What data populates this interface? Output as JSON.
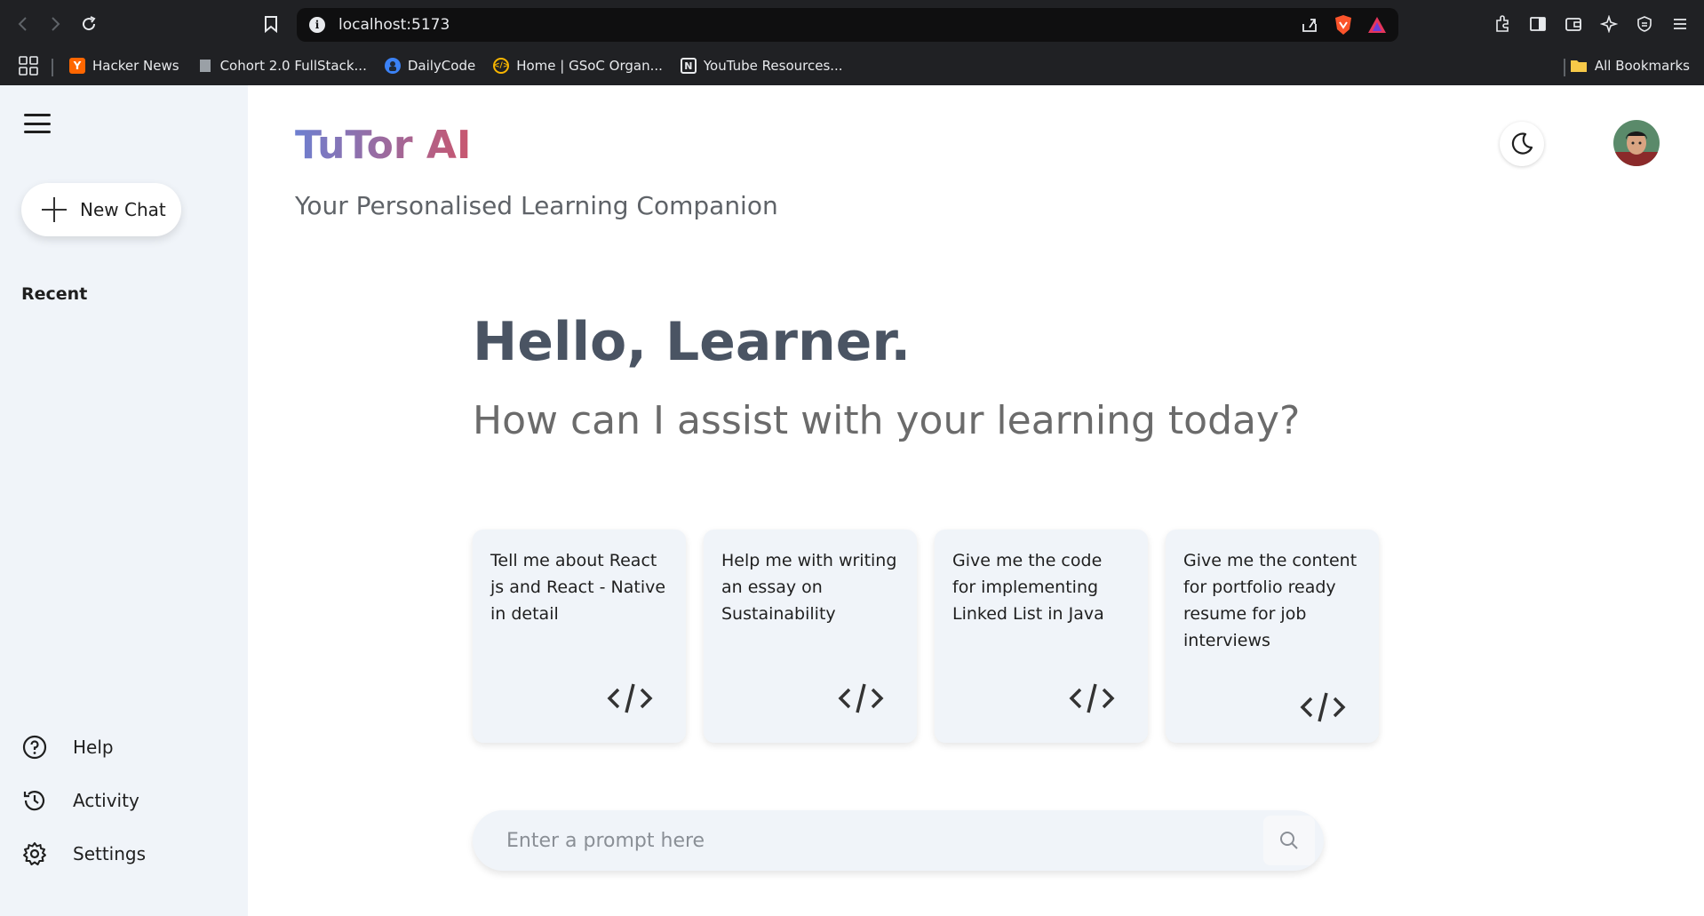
{
  "browser": {
    "url": "localhost:5173",
    "bookmarks": [
      {
        "label": "Hacker News",
        "icon": "hacker-news-icon",
        "color": "#ff6600"
      },
      {
        "label": "Cohort 2.0 FullStack...",
        "icon": "document-icon",
        "color": "#9aa0a6"
      },
      {
        "label": "DailyCode",
        "icon": "dailycode-icon",
        "color": "#3b82f6"
      },
      {
        "label": "Home | GSoC Organ...",
        "icon": "gsoc-icon",
        "color": "#f7b500"
      },
      {
        "label": "YouTube Resources...",
        "icon": "notion-icon",
        "color": "#ffffff"
      }
    ],
    "all_bookmarks": "All Bookmarks"
  },
  "sidebar": {
    "new_chat": "New Chat",
    "recent_heading": "Recent",
    "links": [
      {
        "label": "Help",
        "icon": "help-icon"
      },
      {
        "label": "Activity",
        "icon": "history-icon"
      },
      {
        "label": "Settings",
        "icon": "gear-icon"
      }
    ]
  },
  "header": {
    "brand": "TuTor AI",
    "tagline": "Your Personalised Learning Companion"
  },
  "main": {
    "greeting": "Hello, Learner.",
    "subgreeting": "How can I assist with your learning today?",
    "cards": [
      {
        "text": "Tell me about React js and React - Native in detail",
        "icon": "code-icon"
      },
      {
        "text": "Help me with writing an essay on Sustainability",
        "icon": "code-icon"
      },
      {
        "text": "Give me the code for implementing Linked List in Java",
        "icon": "code-icon"
      },
      {
        "text": "Give me the content for portfolio ready resume for job interviews",
        "icon": "code-icon"
      }
    ],
    "prompt_placeholder": "Enter a prompt here"
  },
  "colors": {
    "brand_gradient_start": "#6d7fd0",
    "brand_gradient_end": "#c9566e",
    "sidebar_bg": "#f0f4f9",
    "card_bg": "#f0f4f9"
  }
}
